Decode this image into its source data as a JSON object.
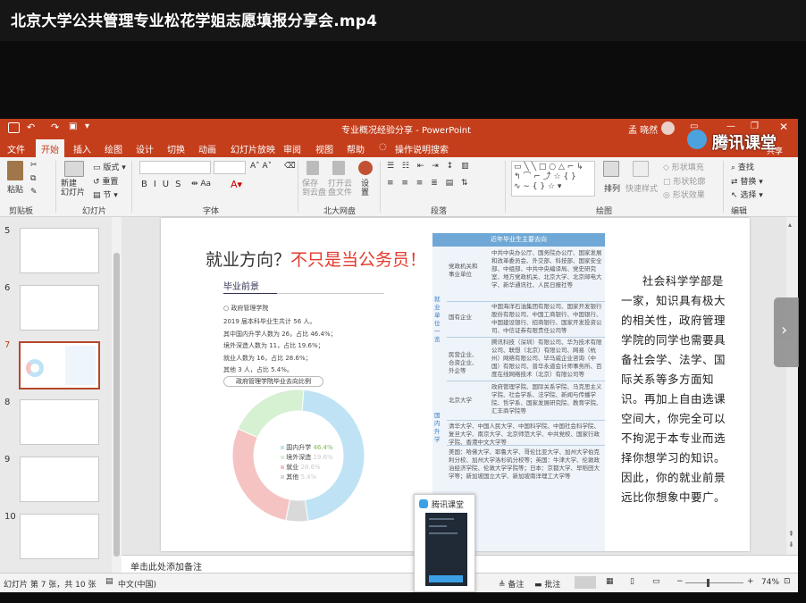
{
  "video": {
    "title": "北京大学公共管理专业松花学姐志愿填报分享会.mp4"
  },
  "window": {
    "title": "专业概况经验分享  -  PowerPoint",
    "user": "孟 晓然",
    "watermark": "腾讯课堂",
    "share": "共享"
  },
  "tabs": [
    "文件",
    "开始",
    "插入",
    "绘图",
    "设计",
    "切换",
    "动画",
    "幻灯片放映",
    "审阅",
    "视图",
    "帮助",
    "操作说明搜索"
  ],
  "ribbon": {
    "paste": "粘贴",
    "clipboard": "剪贴板",
    "new_slide": "新建\n幻灯片",
    "layout": "版式",
    "reset": "重置",
    "section": "节",
    "slides_group": "幻灯片",
    "font_group": "字体",
    "save_to_disk": "保存\n到云盘",
    "open_disk": "打开云\n盘文件",
    "settings": "设\n置",
    "disk_group": "北大网盘",
    "paragraph_group": "段落",
    "arrange": "排列",
    "quick_styles": "快速样式",
    "shape_fill": "形状填充",
    "shape_outline": "形状轮廓",
    "shape_effects": "形状效果",
    "drawing_group": "绘图",
    "find": "查找",
    "replace": "替换",
    "select": "选择",
    "editing_group": "编辑"
  },
  "slide_numbers": [
    "5",
    "6",
    "7",
    "8",
    "9",
    "10"
  ],
  "slide": {
    "heading_plain": "就业方向？",
    "heading_red": "不只是当公务员！",
    "sub_heading": "毕业前景",
    "org": "政府管理学院",
    "stats": [
      "2019 届本科毕业生共计 56 人。",
      "其中国内升学人数为 26，占比 46.4%；",
      "境外深造人数为 11，占比 19.6%；",
      "就业人数为 16，占比 28.6%；",
      "其他 3 人，占比 5.4%。"
    ],
    "chart_caption": "政府管理学院毕业去向比例",
    "table_title": "近年毕业生主要去向",
    "table_left_col": "就业单位一览",
    "table_left_col2": "国内升学",
    "table_rows": [
      {
        "cat": "党政机关和事业单位",
        "text": "中共中央办公厅、国务院办公厅、国家发展和改革委员会、外交部、科技部、国家安全部、中组部、中共中央编译局、党史研究室、地方党政机关、北京大学、北京邮电大学、新华通讯社、人民日报社等"
      },
      {
        "cat": "国有企业",
        "text": "中国海洋石油集团有限公司、国家开发银行股份有限公司、中国工商银行、中国银行、中国建设银行、招商银行、国家开发投资公司、中信证券有限责任公司等"
      },
      {
        "cat": "民营企业、合资企业、外企等",
        "text": "腾讯科技（深圳）有限公司、华为技术有限公司、联想（北京）有限公司、网易（杭州）网络有限公司、毕马威企业咨询（中国）有限公司、普华永道会计师事务所、百度在线网络技术（北京）有限公司等"
      },
      {
        "cat": "北京大学",
        "text": "政府管理学院、国际关系学院、马克思主义学院、社会学系、法学院、新闻与传播学院、哲学系、国家发展研究院、教育学院、汇丰商学院等"
      },
      {
        "cat": "",
        "text": "清华大学、中国人民大学、中国科学院、中国社会科学院、复旦大学、南京大学、北京师范大学、中共党校、国家行政学院、香港中文大学等"
      },
      {
        "cat": "",
        "text": "美国：哈佛大学、耶鲁大学、哥伦比亚大学、加州大学伯克利分校、加州大学洛杉矶分校等；英国：牛津大学、伦敦政治经济学院、伦敦大学学院等；日本：京都大学、早稻田大学等；新加坡国立大学、新加坡南洋理工大学等"
      }
    ],
    "right_paragraph": "社会科学学部是一家，知识具有极大的相关性，政府管理学院的同学也需要具备社会学、法学、国际关系等多方面知识。再加上自由选课空间大，你完全可以不拘泥于本专业而选择你想学习的知识。因此，你的就业前景远比你想象中要广。"
  },
  "chart_data": {
    "type": "pie",
    "title": "政府管理学院毕业去向比例",
    "categories": [
      "国内升学",
      "境外深造",
      "就业",
      "其他"
    ],
    "values": [
      46.4,
      19.6,
      28.6,
      5.4
    ],
    "value_labels": [
      "46.4%",
      "19.6%",
      "28.6%",
      "5.4%"
    ],
    "colors": [
      "#bfe3f5",
      "#d6f0d2",
      "#f6c3c3",
      "#d9d9d9"
    ]
  },
  "notes": {
    "placeholder": "单击此处添加备注"
  },
  "status": {
    "slide_info": "幻灯片 第 7 张，共 10 张",
    "lang": "中文(中国)",
    "notes_btn": "备注",
    "comments_btn": "批注",
    "zoom": "74%"
  },
  "popup": {
    "title": "腾讯课堂"
  }
}
